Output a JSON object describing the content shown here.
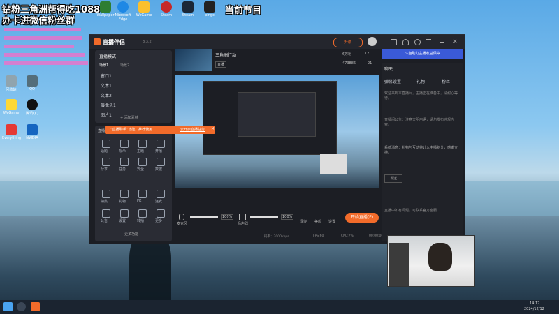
{
  "overlay": {
    "line1": "钻粉三角洲帮得吃1088w",
    "line2": "办卡进微信粉丝群",
    "program": "当前节目"
  },
  "desktop": {
    "icons": [
      {
        "label": "Wallpaper"
      },
      {
        "label": "Microsoft Edge"
      },
      {
        "label": "WeGame"
      },
      {
        "label": "Steam"
      },
      {
        "label": "Steam"
      },
      {
        "label": "pingc"
      },
      {
        "label": "回收站"
      },
      {
        "label": "QQ"
      },
      {
        "label": "WeGame"
      },
      {
        "label": "腾讯QQ"
      },
      {
        "label": "Everything"
      },
      {
        "label": "NVIDIA"
      }
    ]
  },
  "app": {
    "title": "直播伴侣",
    "version": "8.3.2",
    "upgrade_btn": "升级",
    "stream_title": "三角洲行动",
    "rank_label": "直播",
    "followers": "6万粉",
    "likes": "12",
    "online": "473886",
    "viewers": "21",
    "banner": "斗鱼助力主播收益保障",
    "scene_mode": "直播模式",
    "scene_tab_a": "场景1",
    "scene_tab_b": "场景2",
    "sources": [
      {
        "label": "窗口1"
      },
      {
        "label": "文本1"
      },
      {
        "label": "文本2"
      },
      {
        "label": "摄像头1"
      },
      {
        "label": "图片1"
      }
    ],
    "add_source": "添加素材",
    "toast": "“直播助手”功能，推荐使用...",
    "toast_link": "去开启直播任务",
    "tools_title": "直播工具",
    "tools_row1": [
      "话题",
      "观众",
      "主题",
      "开播"
    ],
    "tools_row2": [
      "分享",
      "任务",
      "安全",
      "数据"
    ],
    "tools_row3": [
      "抽奖",
      "礼物",
      "PK",
      "连麦"
    ],
    "tools_row4": [
      "公告",
      "设置",
      "转播",
      "更多"
    ],
    "more_tools": "更多功能",
    "mic_label": "麦克风",
    "mic_level": "100%",
    "spk_label": "扬声器",
    "spk_level": "100%",
    "ctrl1": "录制",
    "ctrl2": "美颜",
    "ctrl3": "设置",
    "start_btn": "开始直播(F)",
    "status_left": "码率：3000kbps",
    "status_fps": "FPS:60",
    "status_cpu": "CPU:7%",
    "status_time": "00:00:00",
    "right_title": "聊天",
    "right_tabs": [
      "弹幕设置",
      "礼物",
      "粉丝"
    ],
    "chat": [
      {
        "text": "欢迎来到本直播间，主播正在准备中，请耐心等待。"
      },
      {
        "text": "直播间公告：注意文明用语，请勿发布违规内容。"
      },
      {
        "text": "系统消息：礼物与互动将计入主播积分，感谢支持。"
      }
    ],
    "chat_btn": "发送",
    "chat_footer": "直播中如有问题，可联系官方客服"
  },
  "taskbar": {
    "time": "14:17",
    "date": "2024/12/12"
  },
  "colors": {
    "accent": "#f26b2a",
    "window_bg": "#1c1e24",
    "panel": "#2a2c34"
  }
}
